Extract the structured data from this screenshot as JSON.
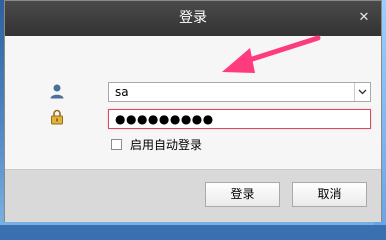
{
  "window": {
    "title": "登录",
    "close_glyph": "✕"
  },
  "form": {
    "username_value": "sa",
    "password_value": "●●●●●●●●●",
    "auto_login_label": "启用自动登录",
    "auto_login_checked": false
  },
  "buttons": {
    "login_label": "登录",
    "cancel_label": "取消"
  },
  "icons": {
    "user": "user-icon",
    "lock": "lock-icon",
    "dropdown": "chevron-down-icon"
  },
  "colors": {
    "arrow": "#ff3b7f",
    "titlebar": "#3a3a3a",
    "password_border": "#d64c5b"
  }
}
